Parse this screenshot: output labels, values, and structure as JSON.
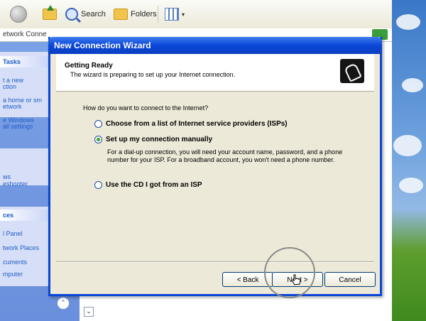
{
  "toolbar": {
    "search_label": "Search",
    "folders_label": "Folders"
  },
  "address": {
    "text": "etwork Conne"
  },
  "taskpane": {
    "tasks_header": "Tasks",
    "task_links": [
      "t a new",
      "ction",
      "a home or sm",
      "etwork",
      "e Windows",
      "all settings"
    ],
    "see_also_links": [
      "ws",
      "eshooter"
    ],
    "places_header": "ces",
    "places_links": [
      "l Panel",
      "twork Places",
      "cuments",
      "mputer"
    ]
  },
  "wizard": {
    "title": "New Connection Wizard",
    "header_title": "Getting Ready",
    "header_subtitle": "The wizard is preparing to set up your Internet connection.",
    "question": "How do you want to connect to the Internet?",
    "option1": "Choose from a list of Internet service providers (ISPs)",
    "option2": "Set up my connection manually",
    "option2_desc": "For a dial-up connection, you will need your account name, password, and a phone number for your ISP. For a broadband account, you won't need a phone number.",
    "option3": "Use the CD I got from an ISP",
    "selected_option": 2,
    "back_label": "< Back",
    "next_label": "Next >",
    "cancel_label": "Cancel"
  }
}
